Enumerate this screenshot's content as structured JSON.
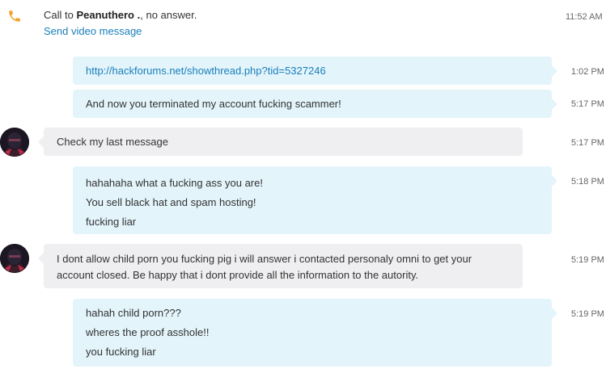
{
  "call": {
    "prefix": "Call to",
    "name": "Peanuthero .",
    "suffix": ", no answer.",
    "time": "11:52 AM",
    "video_link": "Send video message"
  },
  "messages": [
    {
      "direction": "out",
      "lines": [
        "http://hackforums.net/showthread.php?tid=5327246"
      ],
      "time": "1:02 PM",
      "is_link": true
    },
    {
      "direction": "out",
      "lines": [
        "And now you terminated my account fucking scammer!"
      ],
      "time": "5:17 PM"
    },
    {
      "direction": "in",
      "lines": [
        "Check my last message"
      ],
      "time": "5:17 PM"
    },
    {
      "direction": "out",
      "lines": [
        "hahahaha what a fucking ass you are!",
        "You sell black hat and spam hosting!",
        "fucking liar"
      ],
      "time": "5:18 PM"
    },
    {
      "direction": "in",
      "lines": [
        "I dont allow child porn you fucking pig i will answer i contacted personaly omni to get your",
        "account closed. Be happy that i dont provide all the information to the autority."
      ],
      "time": "5:19 PM"
    },
    {
      "direction": "out",
      "lines": [
        "hahah child porn???",
        "wheres the proof asshole!!",
        "you fucking liar"
      ],
      "time": "5:19 PM"
    }
  ],
  "colors": {
    "link": "#1a7fba",
    "outgoing_bubble": "#e3f4fb",
    "incoming_bubble": "#efeff1",
    "call_icon": "#f0a22a"
  },
  "icons": {
    "call": "phone-icon",
    "avatar": "avatar"
  }
}
